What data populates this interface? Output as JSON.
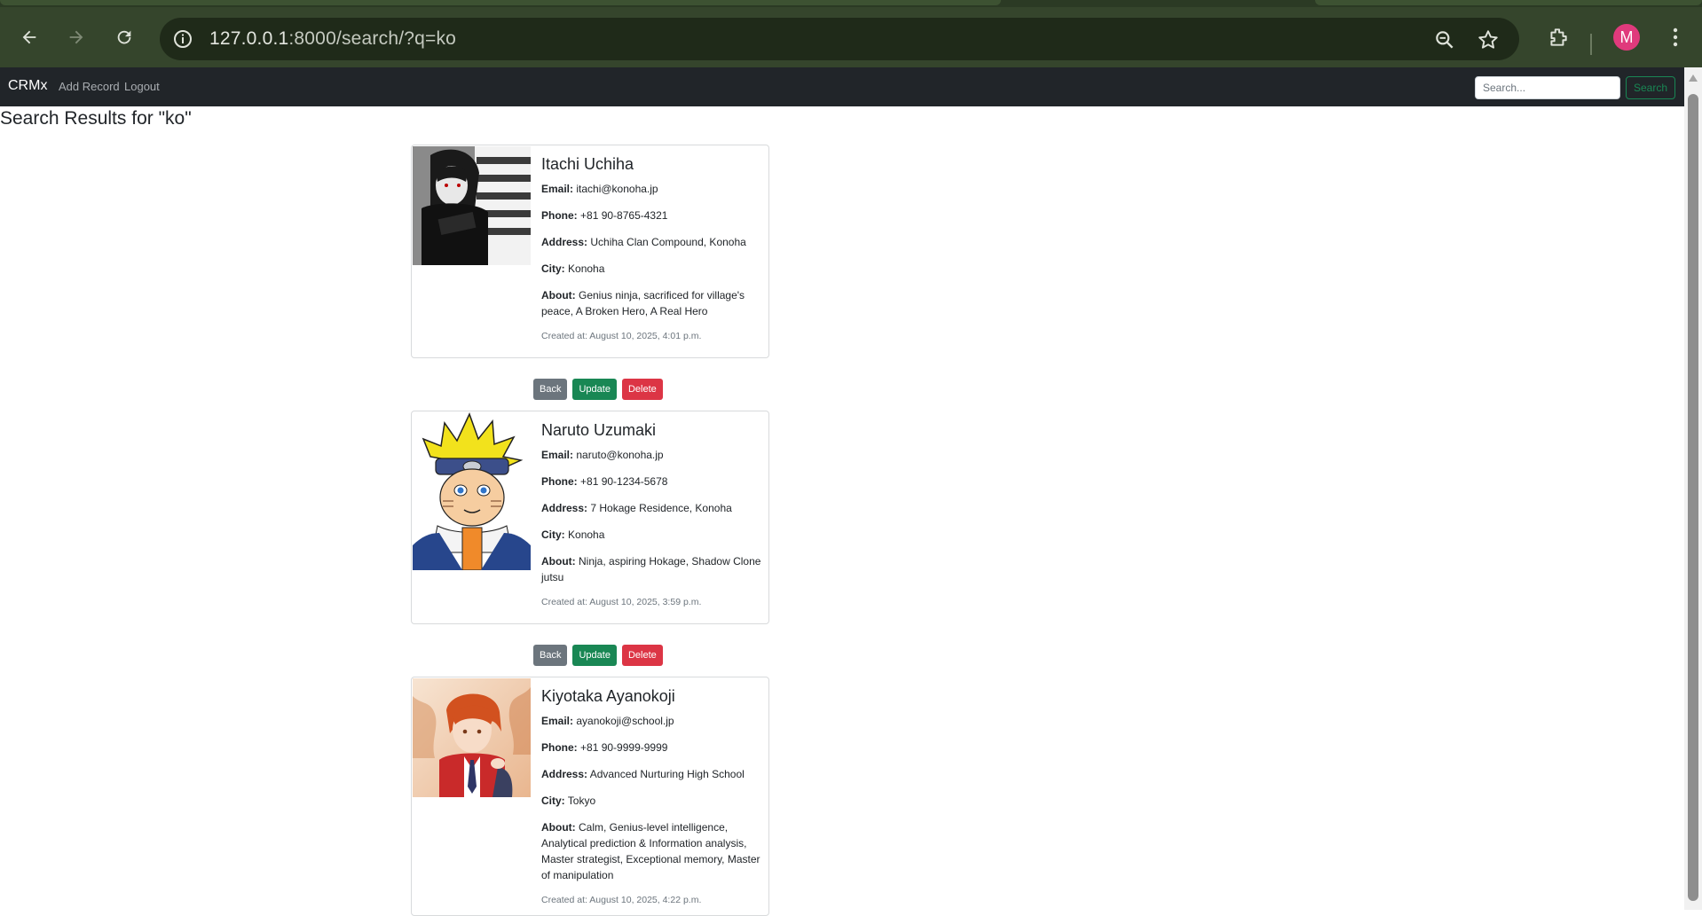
{
  "browser": {
    "url_host": "127.0.0.1",
    "url_rest": ":8000/search/?q=ko",
    "profile_initial": "M"
  },
  "nav": {
    "brand": "CRMx",
    "links": [
      "Add Record",
      "Logout"
    ],
    "search_placeholder": "Search...",
    "search_button": "Search"
  },
  "page": {
    "title": "Search Results for \"ko\""
  },
  "labels": {
    "email": "Email:",
    "phone": "Phone:",
    "address": "Address:",
    "city": "City:",
    "about": "About:"
  },
  "actions": {
    "back": "Back",
    "update": "Update",
    "delete": "Delete"
  },
  "records": [
    {
      "name": "Itachi Uchiha",
      "email": "itachi@konoha.jp",
      "phone": "+81 90-8765-4321",
      "address": "Uchiha Clan Compound, Konoha",
      "city": "Konoha",
      "about": "Genius ninja, sacrificed for village's peace, A Broken Hero, A Real Hero",
      "created": "Created at: August 10, 2025, 4:01 p.m."
    },
    {
      "name": "Naruto Uzumaki",
      "email": "naruto@konoha.jp",
      "phone": "+81 90-1234-5678",
      "address": "7 Hokage Residence, Konoha",
      "city": "Konoha",
      "about": "Ninja, aspiring Hokage, Shadow Clone jutsu",
      "created": "Created at: August 10, 2025, 3:59 p.m."
    },
    {
      "name": "Kiyotaka Ayanokoji",
      "email": "ayanokoji@school.jp",
      "phone": "+81 90-9999-9999",
      "address": "Advanced Nurturing High School",
      "city": "Tokyo",
      "about": "Calm, Genius-level intelligence, Analytical prediction & Information analysis, Master strategist, Exceptional memory, Master of manipulation",
      "created": "Created at: August 10, 2025, 4:22 p.m."
    }
  ],
  "colors": {
    "navbar": "#212529",
    "success": "#198754",
    "danger": "#dc3545",
    "secondary": "#6c757d"
  }
}
